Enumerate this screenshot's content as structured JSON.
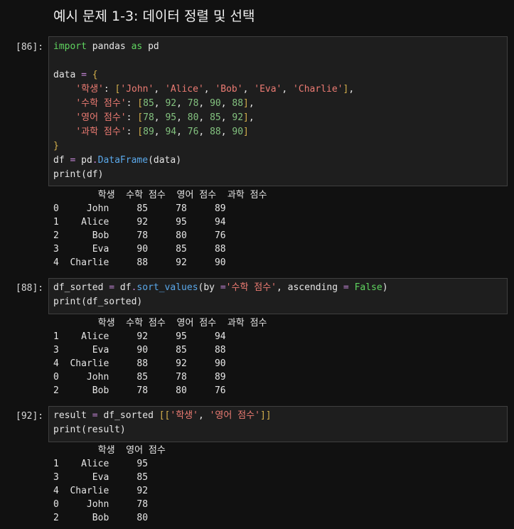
{
  "heading": "예시 문제 1-3: 데이터 정렬 및 선택",
  "cells": [
    {
      "prompt": "[86]:",
      "code": [
        [
          [
            "kw",
            "import"
          ],
          [
            "pl",
            " pandas "
          ],
          [
            "kw",
            "as"
          ],
          [
            "pl",
            " pd"
          ]
        ],
        [],
        [
          [
            "pl",
            "data "
          ],
          [
            "op",
            "="
          ],
          [
            "pl",
            " "
          ],
          [
            "br",
            "{"
          ]
        ],
        [
          [
            "pl",
            "    "
          ],
          [
            "str",
            "'학생'"
          ],
          [
            "pl",
            ": "
          ],
          [
            "br",
            "["
          ],
          [
            "str",
            "'John'"
          ],
          [
            "pl",
            ", "
          ],
          [
            "str",
            "'Alice'"
          ],
          [
            "pl",
            ", "
          ],
          [
            "str",
            "'Bob'"
          ],
          [
            "pl",
            ", "
          ],
          [
            "str",
            "'Eva'"
          ],
          [
            "pl",
            ", "
          ],
          [
            "str",
            "'Charlie'"
          ],
          [
            "br",
            "]"
          ],
          [
            "pl",
            ","
          ]
        ],
        [
          [
            "pl",
            "    "
          ],
          [
            "str",
            "'수학 점수'"
          ],
          [
            "pl",
            ": "
          ],
          [
            "br",
            "["
          ],
          [
            "num",
            "85"
          ],
          [
            "pl",
            ", "
          ],
          [
            "num",
            "92"
          ],
          [
            "pl",
            ", "
          ],
          [
            "num",
            "78"
          ],
          [
            "pl",
            ", "
          ],
          [
            "num",
            "90"
          ],
          [
            "pl",
            ", "
          ],
          [
            "num",
            "88"
          ],
          [
            "br",
            "]"
          ],
          [
            "pl",
            ","
          ]
        ],
        [
          [
            "pl",
            "    "
          ],
          [
            "str",
            "'영어 점수'"
          ],
          [
            "pl",
            ": "
          ],
          [
            "br",
            "["
          ],
          [
            "num",
            "78"
          ],
          [
            "pl",
            ", "
          ],
          [
            "num",
            "95"
          ],
          [
            "pl",
            ", "
          ],
          [
            "num",
            "80"
          ],
          [
            "pl",
            ", "
          ],
          [
            "num",
            "85"
          ],
          [
            "pl",
            ", "
          ],
          [
            "num",
            "92"
          ],
          [
            "br",
            "]"
          ],
          [
            "pl",
            ","
          ]
        ],
        [
          [
            "pl",
            "    "
          ],
          [
            "str",
            "'과학 점수'"
          ],
          [
            "pl",
            ": "
          ],
          [
            "br",
            "["
          ],
          [
            "num",
            "89"
          ],
          [
            "pl",
            ", "
          ],
          [
            "num",
            "94"
          ],
          [
            "pl",
            ", "
          ],
          [
            "num",
            "76"
          ],
          [
            "pl",
            ", "
          ],
          [
            "num",
            "88"
          ],
          [
            "pl",
            ", "
          ],
          [
            "num",
            "90"
          ],
          [
            "br",
            "]"
          ]
        ],
        [
          [
            "br",
            "}"
          ]
        ],
        [
          [
            "pl",
            "df "
          ],
          [
            "op",
            "="
          ],
          [
            "pl",
            " pd"
          ],
          [
            "op",
            "."
          ],
          [
            "fn",
            "DataFrame"
          ],
          [
            "pl",
            "(data)"
          ]
        ],
        [
          [
            "pl",
            "print(df)"
          ]
        ]
      ],
      "output": [
        "        학생  수학 점수  영어 점수  과학 점수",
        "0     John     85     78     89",
        "1    Alice     92     95     94",
        "2      Bob     78     80     76",
        "3      Eva     90     85     88",
        "4  Charlie     88     92     90"
      ]
    },
    {
      "prompt": "[88]:",
      "code": [
        [
          [
            "pl",
            "df_sorted "
          ],
          [
            "op",
            "="
          ],
          [
            "pl",
            " df"
          ],
          [
            "op",
            "."
          ],
          [
            "fn",
            "sort_values"
          ],
          [
            "pl",
            "(by "
          ],
          [
            "op",
            "="
          ],
          [
            "str",
            "'수학 점수'"
          ],
          [
            "pl",
            ", ascending "
          ],
          [
            "op",
            "="
          ],
          [
            "pl",
            " "
          ],
          [
            "kw",
            "False"
          ],
          [
            "pl",
            ")"
          ]
        ],
        [
          [
            "pl",
            "print(df_sorted)"
          ]
        ]
      ],
      "output": [
        "        학생  수학 점수  영어 점수  과학 점수",
        "1    Alice     92     95     94",
        "3      Eva     90     85     88",
        "4  Charlie     88     92     90",
        "0     John     85     78     89",
        "2      Bob     78     80     76"
      ]
    },
    {
      "prompt": "[92]:",
      "code": [
        [
          [
            "pl",
            "result "
          ],
          [
            "op",
            "="
          ],
          [
            "pl",
            " df_sorted "
          ],
          [
            "br",
            "[["
          ],
          [
            "str",
            "'학생'"
          ],
          [
            "pl",
            ", "
          ],
          [
            "str",
            "'영어 점수'"
          ],
          [
            "br",
            "]]"
          ]
        ],
        [
          [
            "pl",
            "print(result)"
          ]
        ]
      ],
      "output": [
        "        학생  영어 점수",
        "1    Alice     95",
        "3      Eva     85",
        "4  Charlie     92",
        "0     John     78",
        "2      Bob     80"
      ]
    }
  ]
}
